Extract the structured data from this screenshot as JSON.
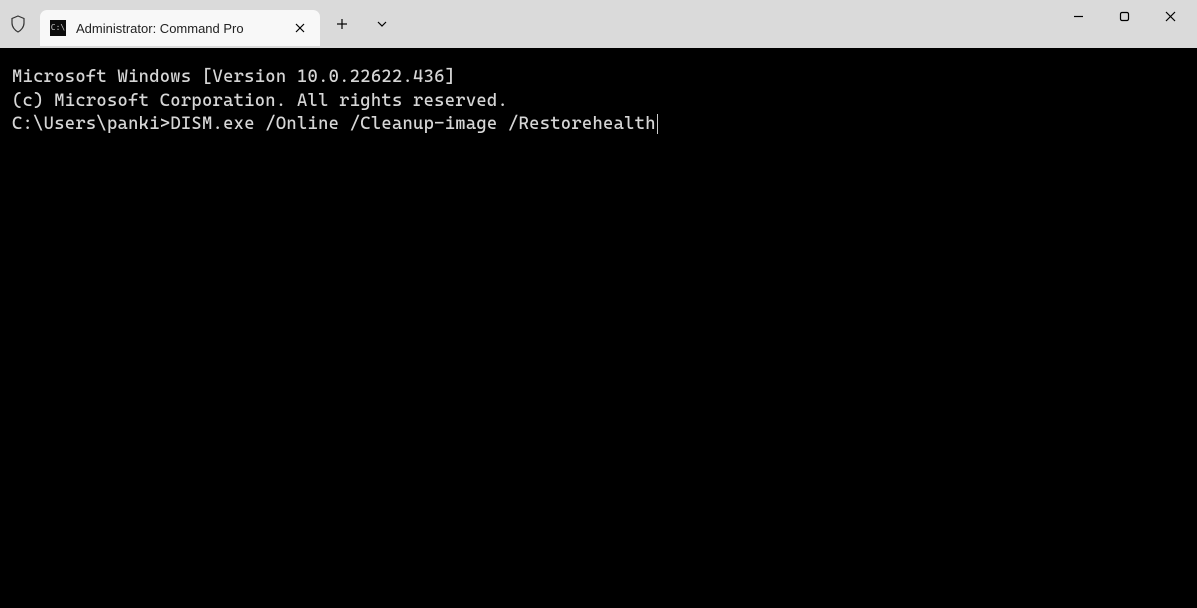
{
  "window": {
    "tab": {
      "icon_label": "C:\\",
      "title": "Administrator: Command Pro"
    },
    "buttons": {
      "new_tab": "+",
      "dropdown": "⌄"
    }
  },
  "terminal": {
    "line1": "Microsoft Windows [Version 10.0.22622.436]",
    "line2": "(c) Microsoft Corporation. All rights reserved.",
    "blank": "",
    "prompt": "C:\\Users\\panki>",
    "command": "DISM.exe /Online /Cleanup-image /Restorehealth"
  }
}
